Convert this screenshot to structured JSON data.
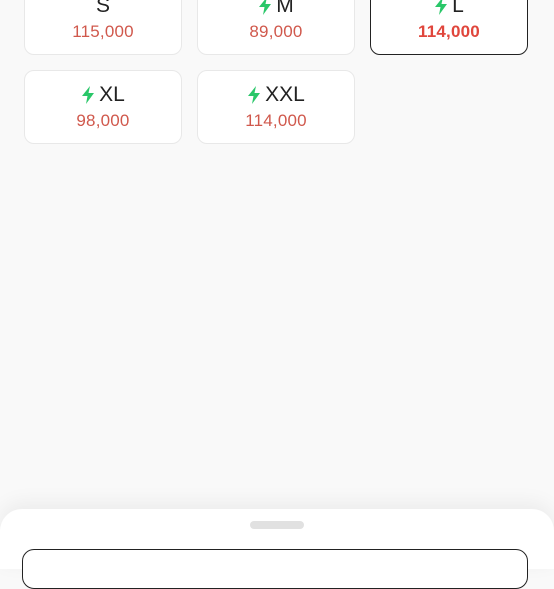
{
  "colors": {
    "bolt": "#2ac769",
    "price": "#d0584c",
    "selected_price": "#e0463c",
    "selected_border": "#222222"
  },
  "sizes": [
    {
      "label": "S",
      "price": "115,000",
      "express": false,
      "selected": false
    },
    {
      "label": "M",
      "price": "89,000",
      "express": true,
      "selected": false
    },
    {
      "label": "L",
      "price": "114,000",
      "express": true,
      "selected": true
    },
    {
      "label": "XL",
      "price": "98,000",
      "express": true,
      "selected": false
    },
    {
      "label": "XXL",
      "price": "114,000",
      "express": true,
      "selected": false
    }
  ],
  "icons": {
    "express": "lightning-bolt-icon"
  }
}
